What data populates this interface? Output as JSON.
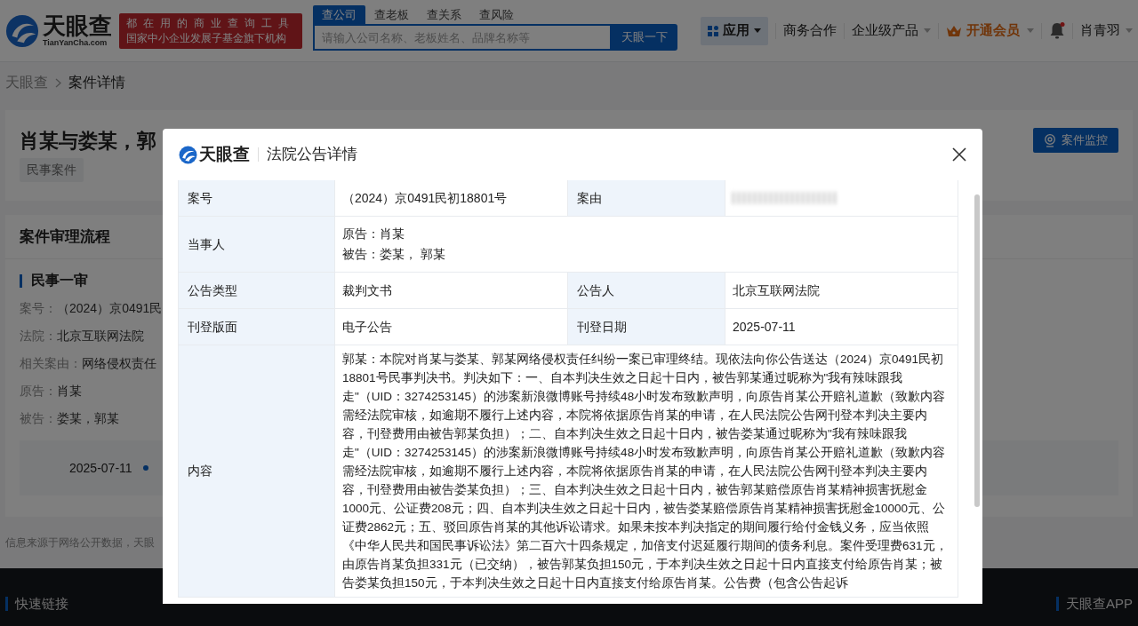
{
  "header": {
    "logo_text": "天眼查",
    "logo_domain": "TianYanCha.com",
    "slogan": [
      "都在用的商业查询工具",
      "国家中小企业发展子基金旗下机构"
    ],
    "search_tabs": [
      {
        "label": "查公司",
        "selected": true
      },
      {
        "label": "查老板",
        "selected": false
      },
      {
        "label": "查关系",
        "selected": false
      },
      {
        "label": "查风险",
        "selected": false
      }
    ],
    "search_placeholder": "请输入公司名称、老板姓名、品牌名称等",
    "search_button": "天眼一下",
    "nav": [
      {
        "kind": "apps",
        "label": "应用"
      },
      {
        "kind": "link",
        "label": "商务合作"
      },
      {
        "kind": "dropdown",
        "label": "企业级产品"
      },
      {
        "kind": "vip",
        "label": "开通会员"
      },
      {
        "kind": "bell",
        "unread": true
      },
      {
        "kind": "user",
        "label": "肖青羽"
      }
    ]
  },
  "breadcrumb": [
    "天眼查",
    "案件详情"
  ],
  "case": {
    "title": "肖某与娄某，郭",
    "tag": "民事案件",
    "monitor_button": "案件监控"
  },
  "process": {
    "heading": "案件审理流程",
    "stage": "民事一审",
    "fields": [
      {
        "label": "案号：",
        "value": "（2024）京0491民"
      },
      {
        "label": "法院：",
        "value": "北京互联网法院"
      },
      {
        "label": "相关案由：",
        "value": "网络侵权责任"
      },
      {
        "label": "原告：",
        "value": "肖某"
      },
      {
        "label": "被告：",
        "value": "娄某，郭某"
      }
    ],
    "timeline_date": "2025-07-11"
  },
  "source_note": "信息来源于网络公开数据，天眼",
  "footer": {
    "links_heading": "快速链接",
    "app_heading": "天眼查APP"
  },
  "modal": {
    "brand": "天眼查",
    "title": "法院公告详情",
    "rows": [
      {
        "cells": [
          {
            "label": "案号",
            "value": "（2024）京0491民初18801号"
          },
          {
            "label": "案由",
            "blurred": true
          }
        ]
      },
      {
        "cells": [
          {
            "label": "当事人",
            "lines": [
              "原告：肖某",
              "被告：娄某， 郭某"
            ]
          }
        ]
      },
      {
        "cells": [
          {
            "label": "公告类型",
            "value": "裁判文书"
          },
          {
            "label": "公告人",
            "value": "北京互联网法院"
          }
        ]
      },
      {
        "cells": [
          {
            "label": "刊登版面",
            "value": "电子公告"
          },
          {
            "label": "刊登日期",
            "value": "2025-07-11"
          }
        ]
      },
      {
        "cells": [
          {
            "label": "内容",
            "value": "郭某：本院对肖某与娄某、郭某网络侵权责任纠纷一案已审理终结。现依法向你公告送达（2024）京0491民初18801号民事判决书。判决如下：一、自本判决生效之日起十日内，被告郭某通过昵称为\"我有辣味跟我走\"（UID：3274253145）的涉案新浪微博账号持续48小时发布致歉声明，向原告肖某公开赔礼道歉（致歉内容需经法院审核，如逾期不履行上述内容，本院将依据原告肖某的申请，在人民法院公告网刊登本判决主要内容，刊登费用由被告郭某负担）；二、自本判决生效之日起十日内，被告娄某通过昵称为\"我有辣味跟我走\"（UID：3274253145）的涉案新浪微博账号持续48小时发布致歉声明，向原告肖某公开赔礼道歉（致歉内容需经法院审核，如逾期不履行上述内容，本院将依据原告肖某的申请，在人民法院公告网刊登本判决主要内容，刊登费用由被告娄某负担）；三、自本判决生效之日起十日内，被告郭某赔偿原告肖某精神损害抚慰金1000元、公证费208元；四、自本判决生效之日起十日内，被告娄某赔偿原告肖某精神损害抚慰金10000元、公证费2862元；五、驳回原告肖某的其他诉讼请求。如果未按本判决指定的期间履行给付金钱义务，应当依照《中华人民共和国民事诉讼法》第二百六十四条规定，加倍支付迟延履行期间的债务利息。案件受理费631元，由原告肖某负担331元（已交纳），被告郭某负担150元，于本判决生效之日起十日内直接支付给原告肖某；被告娄某负担150元，于本判决生效之日起十日内直接支付给原告肖某。公告费（包含公告起诉"
          }
        ]
      }
    ]
  }
}
